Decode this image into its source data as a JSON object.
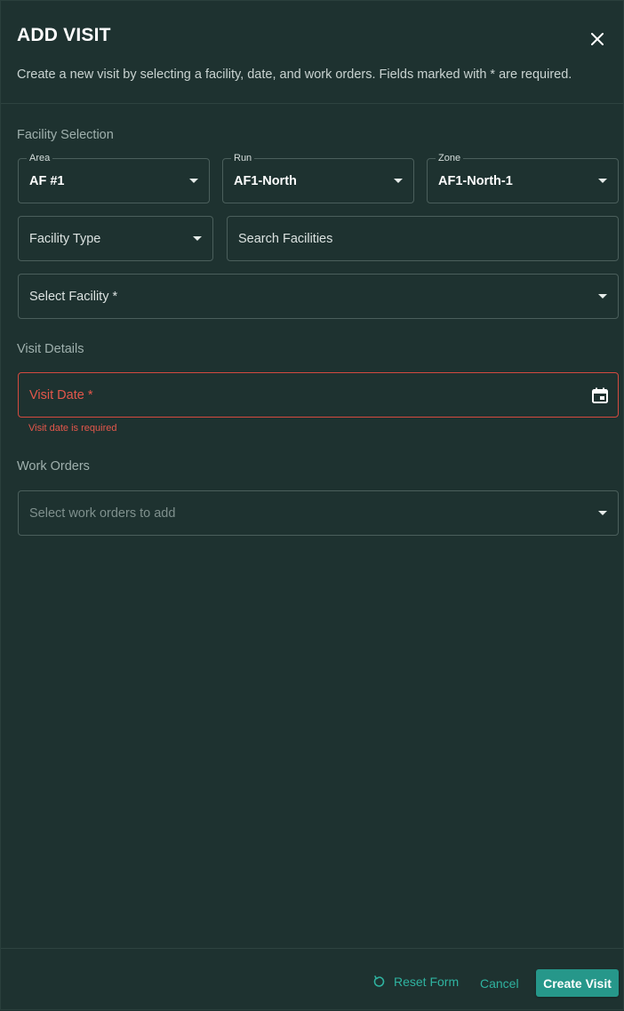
{
  "dialog": {
    "title": "ADD VISIT",
    "subtitle": "Create a new visit by selecting a facility, date, and work orders. Fields marked with * are required."
  },
  "facility_selection": {
    "label": "Facility Selection",
    "area": {
      "label": "Area",
      "value": "AF #1"
    },
    "run": {
      "label": "Run",
      "value": "AF1-North"
    },
    "zone": {
      "label": "Zone",
      "value": "AF1-North-1"
    },
    "facility_type": {
      "placeholder": "Facility Type"
    },
    "search": {
      "placeholder": "Search Facilities"
    },
    "select_facility": {
      "placeholder": "Select Facility *"
    }
  },
  "visit_details": {
    "label": "Visit Details",
    "visit_date": {
      "placeholder": "Visit Date *",
      "error": "Visit date is required"
    }
  },
  "work_orders": {
    "label": "Work Orders",
    "select": {
      "placeholder": "Select work orders to add"
    }
  },
  "footer": {
    "reset_label": "Reset Form",
    "cancel_label": "Cancel",
    "create_label": "Create Visit"
  },
  "colors": {
    "background": "#1e3230",
    "accent": "#26978a",
    "error": "#e4574b"
  },
  "icons": {
    "close": "close-icon",
    "caret": "chevron-down-icon",
    "calendar": "calendar-icon",
    "reset": "refresh-icon"
  }
}
